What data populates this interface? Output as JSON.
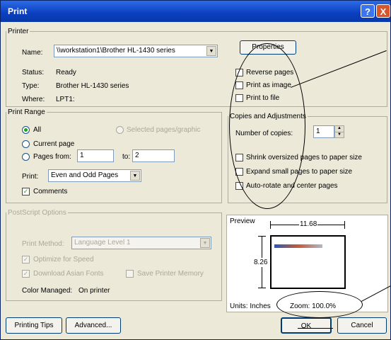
{
  "window": {
    "title": "Print",
    "help_label": "?",
    "close_label": "X"
  },
  "printer": {
    "legend": "Printer",
    "name_label": "Name:",
    "name_value": "\\\\workstation1\\Brother HL-1430 series",
    "properties_label": "Properties",
    "status_label": "Status:",
    "status_value": "Ready",
    "type_label": "Type:",
    "type_value": "Brother HL-1430 series",
    "where_label": "Where:",
    "where_value": "LPT1:",
    "reverse_pages": "Reverse pages",
    "print_as_image": "Print as image",
    "print_to_file": "Print to file"
  },
  "print_range": {
    "legend": "Print Range",
    "all": "All",
    "selected": "Selected pages/graphic",
    "current": "Current page",
    "pages_from": "Pages from:",
    "from_value": "1",
    "to_label": "to:",
    "to_value": "2",
    "print_label": "Print:",
    "print_value": "Even and Odd Pages",
    "comments": "Comments"
  },
  "copies": {
    "legend": "Copies and Adjustments",
    "number_label": "Number of copies:",
    "number_value": "1",
    "shrink": "Shrink oversized pages to paper size",
    "expand": "Expand small pages to paper size",
    "auto_rotate": "Auto-rotate and center pages"
  },
  "postscript": {
    "legend": "PostScript Options",
    "method_label": "Print Method:",
    "method_value": "Language Level 1",
    "optimize": "Optimize for Speed",
    "download": "Download Asian Fonts",
    "save_memory": "Save Printer Memory",
    "color_label": "Color Managed:",
    "color_value": "On printer"
  },
  "preview": {
    "label": "Preview",
    "width": "11.68",
    "height": "8.26",
    "units": "Units: Inches",
    "zoom": "Zoom: 100.0%"
  },
  "buttons": {
    "tips": "Printing Tips",
    "advanced": "Advanced...",
    "ok": "OK",
    "cancel": "Cancel"
  }
}
